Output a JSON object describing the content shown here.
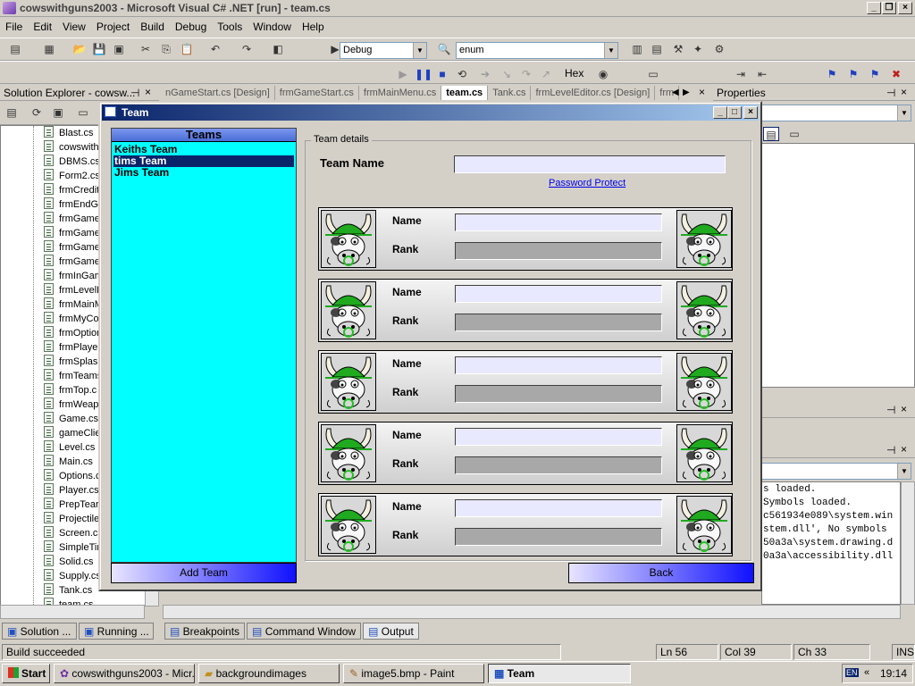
{
  "window": {
    "title": "cowswithguns2003 - Microsoft Visual C# .NET [run] - team.cs"
  },
  "menu": [
    "File",
    "Edit",
    "View",
    "Project",
    "Build",
    "Debug",
    "Tools",
    "Window",
    "Help"
  ],
  "toolbar": {
    "config": "Debug",
    "find": "enum",
    "hex_label": "Hex"
  },
  "solution_explorer": {
    "title": "Solution Explorer - cowsw...",
    "files": [
      "Blast.cs",
      "cowswith",
      "DBMS.cs",
      "Form2.cs",
      "frmCredit",
      "frmEndGa",
      "frmGame",
      "frmGame",
      "frmGame",
      "frmGame",
      "frmInGam",
      "frmLevelE",
      "frmMainM",
      "frmMyCo",
      "frmOption",
      "frmPlayer",
      "frmSplash",
      "frmTeams",
      "frmTop.c",
      "frmWeap",
      "Game.cs",
      "gameClie",
      "Level.cs",
      "Main.cs",
      "Options.c",
      "Player.cs",
      "PrepTear",
      "Projectile",
      "Screen.cs",
      "SimpleTin",
      "Solid.cs",
      "Supply.cs",
      "Tank.cs",
      "team.cs"
    ]
  },
  "doc_tabs": [
    "nGameStart.cs [Design]",
    "frmGameStart.cs",
    "frmMainMenu.cs",
    "team.cs",
    "Tank.cs",
    "frmLevelEditor.cs [Design]",
    "frm"
  ],
  "active_tab": "team.cs",
  "properties": {
    "title": "Properties"
  },
  "output_lines": [
    "s loaded.",
    "Symbols loaded.",
    "c561934e089\\system.win",
    "stem.dll', No symbols",
    "50a3a\\system.drawing.d",
    "0a3a\\accessibility.dll"
  ],
  "bottom_tabs_left": [
    "Solution ...",
    "Running ..."
  ],
  "bottom_tabs": [
    "Breakpoints",
    "Command Window",
    "Output"
  ],
  "status": {
    "message": "Build succeeded",
    "ln": "Ln 56",
    "col": "Col 39",
    "ch": "Ch 33",
    "ins": "INS"
  },
  "taskbar": {
    "start": "Start",
    "items": [
      "cowswithguns2003 - Micr...",
      "backgroundimages",
      "image5.bmp - Paint",
      "Team"
    ],
    "clock": "19:14",
    "lang": "EN"
  },
  "dialog": {
    "title": "Team",
    "teams_header": "Teams",
    "teams": [
      "Keiths Team",
      "tims Team",
      "Jims Team"
    ],
    "selected_team": "tims Team",
    "add_team": "Add Team",
    "back": "Back",
    "group_label": "Team details",
    "team_name_label": "Team Name",
    "team_name_value": "",
    "password_link": "Password Protect",
    "name_label": "Name",
    "rank_label": "Rank",
    "players": [
      {
        "name": "",
        "rank": ""
      },
      {
        "name": "",
        "rank": ""
      },
      {
        "name": "",
        "rank": ""
      },
      {
        "name": "",
        "rank": ""
      },
      {
        "name": "",
        "rank": ""
      }
    ]
  }
}
